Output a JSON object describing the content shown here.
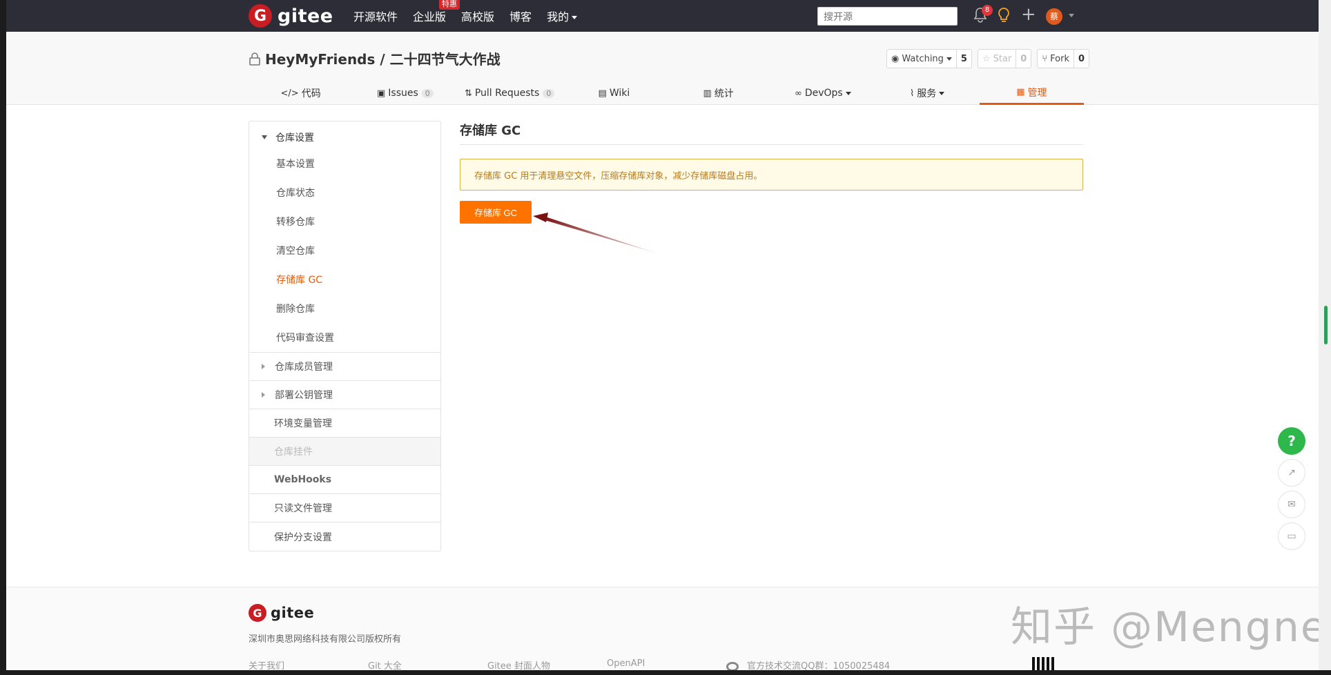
{
  "nav": {
    "logo_glyph": "G",
    "logo_text": "gitee",
    "links": [
      "开源软件",
      "企业版",
      "高校版",
      "博客"
    ],
    "hot_badge": "特惠",
    "mine": "我的",
    "search_placeholder": "搜开源",
    "notifications": "8",
    "avatar_text": "蔡"
  },
  "repo": {
    "title": "HeyMyFriends / 二十四节气大作战",
    "watching_label": "Watching",
    "watching_count": "5",
    "star_label": "Star",
    "star_count": "0",
    "fork_label": "Fork",
    "fork_count": "0"
  },
  "tabs": [
    {
      "label": "代码",
      "icon": "code-icon"
    },
    {
      "label": "Issues",
      "count": "0",
      "icon": "issues-icon"
    },
    {
      "label": "Pull Requests",
      "count": "0",
      "icon": "pull-request-icon"
    },
    {
      "label": "Wiki",
      "icon": "wiki-icon"
    },
    {
      "label": "统计",
      "icon": "stats-icon"
    },
    {
      "label": "DevOps",
      "icon": "devops-icon"
    },
    {
      "label": "服务",
      "icon": "service-icon"
    },
    {
      "label": "管理",
      "icon": "manage-icon",
      "active": true
    }
  ],
  "sidebar": {
    "group_title": "仓库设置",
    "items": [
      "基本设置",
      "仓库状态",
      "转移仓库",
      "清空仓库",
      "存储库 GC",
      "删除仓库",
      "代码审查设置"
    ],
    "active_item": "存储库 GC",
    "member_mgmt": "仓库成员管理",
    "deploy_key": "部署公钥管理",
    "env_vars": "环境变量管理",
    "plugins": "仓库挂件",
    "webhooks": "WebHooks",
    "readonly": "只读文件管理",
    "branch_protect": "保护分支设置"
  },
  "main": {
    "title": "存储库 GC",
    "notice": "存储库 GC 用于清理悬空文件，压缩存储库对象，减少存储库磁盘占用。",
    "button": "存储库 GC"
  },
  "float": {
    "help": "?"
  },
  "footer": {
    "logo_text": "gitee",
    "copyright": "深圳市奥思网络科技有限公司版权所有",
    "links": [
      "关于我们",
      "Git 大全",
      "Gitee 封面人物",
      "OpenAPI",
      "官方技术交流QQ群：1050025484"
    ]
  },
  "watermark": "知乎 @Mengner",
  "colors": {
    "accent": "#fe7300",
    "nav_bg": "#2d2d37",
    "help_green": "#2eb74a",
    "notice_bg": "#fffbe6"
  }
}
